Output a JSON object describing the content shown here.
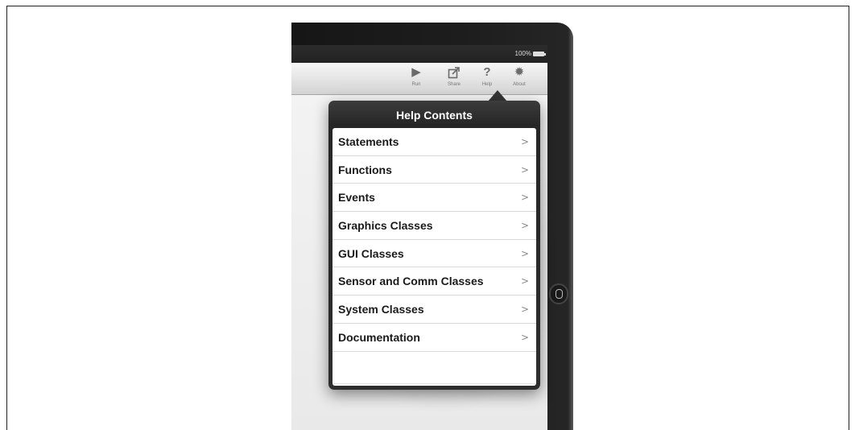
{
  "status_bar": {
    "battery": "100%"
  },
  "toolbar": {
    "items": [
      {
        "label": "Run",
        "icon": "play-icon"
      },
      {
        "label": "Share",
        "icon": "share-icon"
      },
      {
        "label": "Help",
        "icon": "help-icon"
      },
      {
        "label": "About",
        "icon": "gear-icon"
      }
    ]
  },
  "popover": {
    "title": "Help Contents",
    "items": [
      {
        "label": "Statements"
      },
      {
        "label": "Functions"
      },
      {
        "label": "Events"
      },
      {
        "label": "Graphics Classes"
      },
      {
        "label": "GUI Classes"
      },
      {
        "label": "Sensor and Comm Classes"
      },
      {
        "label": "System Classes"
      },
      {
        "label": "Documentation"
      }
    ],
    "chevron": ">"
  }
}
